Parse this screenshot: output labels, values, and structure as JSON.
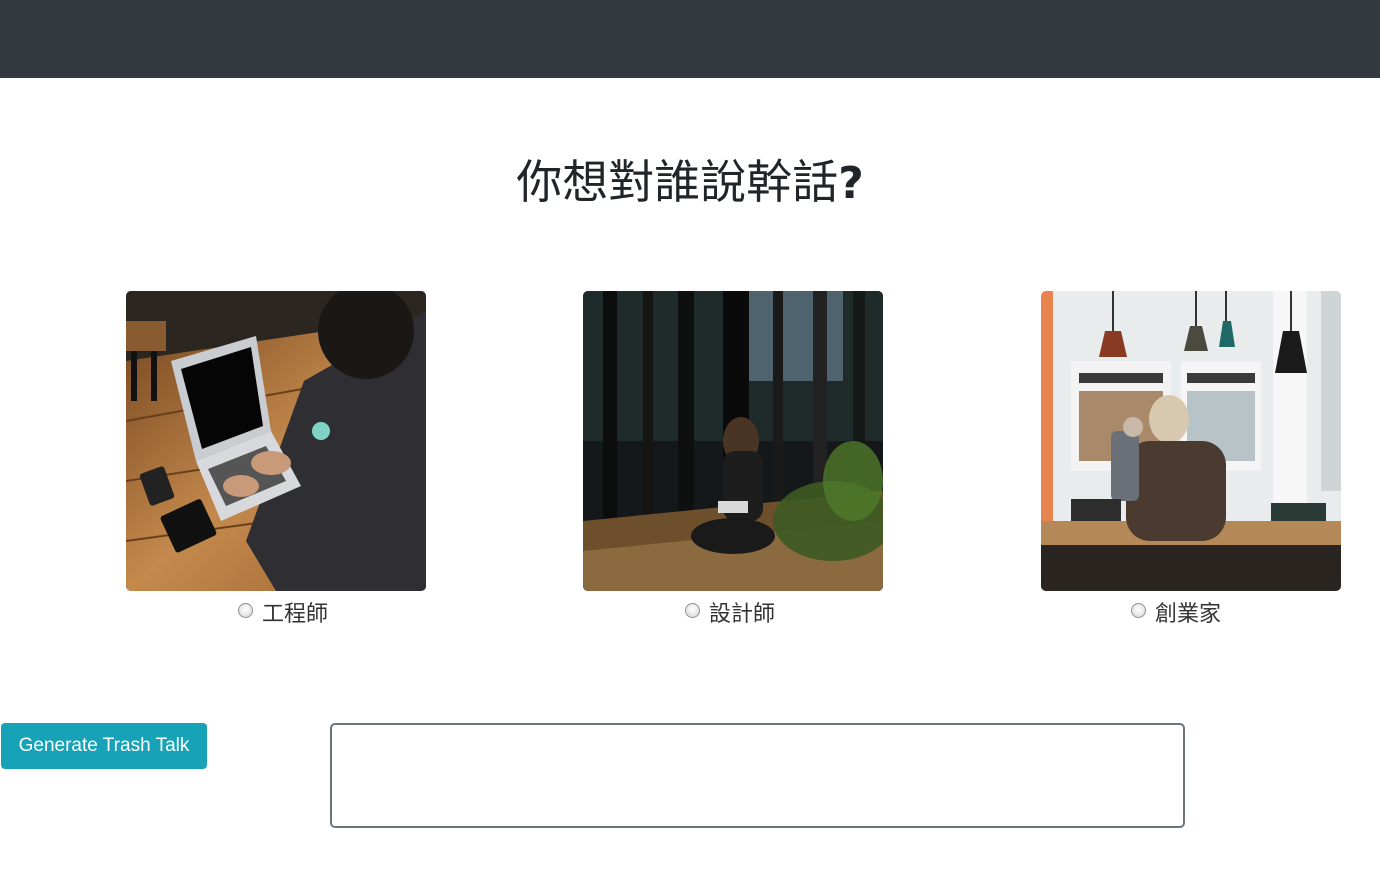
{
  "heading": {
    "text": "你想對誰說幹話",
    "mark": "?"
  },
  "roles": [
    {
      "label": "工程師",
      "selected": false,
      "photo_icon": "laptop-desk-photo"
    },
    {
      "label": "設計師",
      "selected": false,
      "photo_icon": "forest-sketching-photo"
    },
    {
      "label": "創業家",
      "selected": false,
      "photo_icon": "cafe-photo"
    }
  ],
  "actions": {
    "generate_label": "Generate Trash Talk"
  },
  "output": {
    "value": ""
  },
  "colors": {
    "navbar": "#343a40",
    "button": "#17a2b8",
    "textarea_border": "#6c757d"
  }
}
